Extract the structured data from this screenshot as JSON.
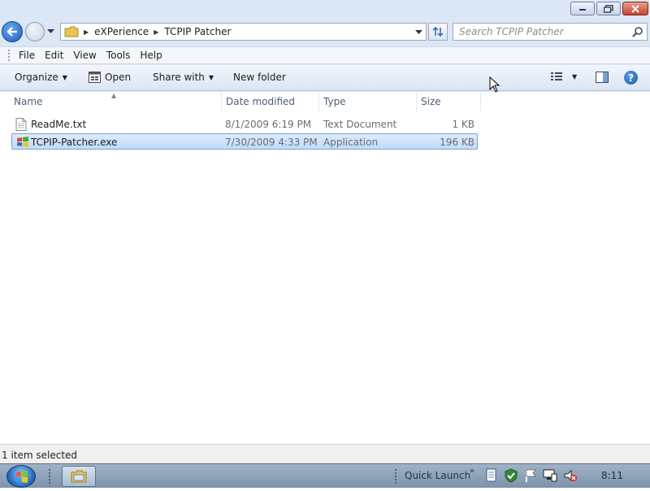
{
  "window": {
    "caption_buttons": [
      "minimize-icon",
      "maximize-icon",
      "close-icon"
    ]
  },
  "address": {
    "breadcrumbs": [
      "eXPerience",
      "TCPIP Patcher"
    ],
    "search_placeholder": "Search TCPIP Patcher"
  },
  "menubar": {
    "items": [
      "File",
      "Edit",
      "View",
      "Tools",
      "Help"
    ]
  },
  "commandbar": {
    "organize": "Organize",
    "open": "Open",
    "share_with": "Share with",
    "new_folder": "New folder"
  },
  "filelist": {
    "columns": [
      "Name",
      "Date modified",
      "Type",
      "Size"
    ],
    "rows": [
      {
        "name": "ReadMe.txt",
        "date": "8/1/2009 6:19 PM",
        "type": "Text Document",
        "size": "1 KB",
        "icon": "text-file-icon",
        "selected": false
      },
      {
        "name": "TCPIP-Patcher.exe",
        "date": "7/30/2009 4:33 PM",
        "type": "Application",
        "size": "196 KB",
        "icon": "application-icon",
        "selected": true
      }
    ]
  },
  "statusbar": {
    "text": "1 item selected"
  },
  "taskbar": {
    "quick_launch": "Quick Launch",
    "chevron": "»",
    "clock": "8:11"
  }
}
